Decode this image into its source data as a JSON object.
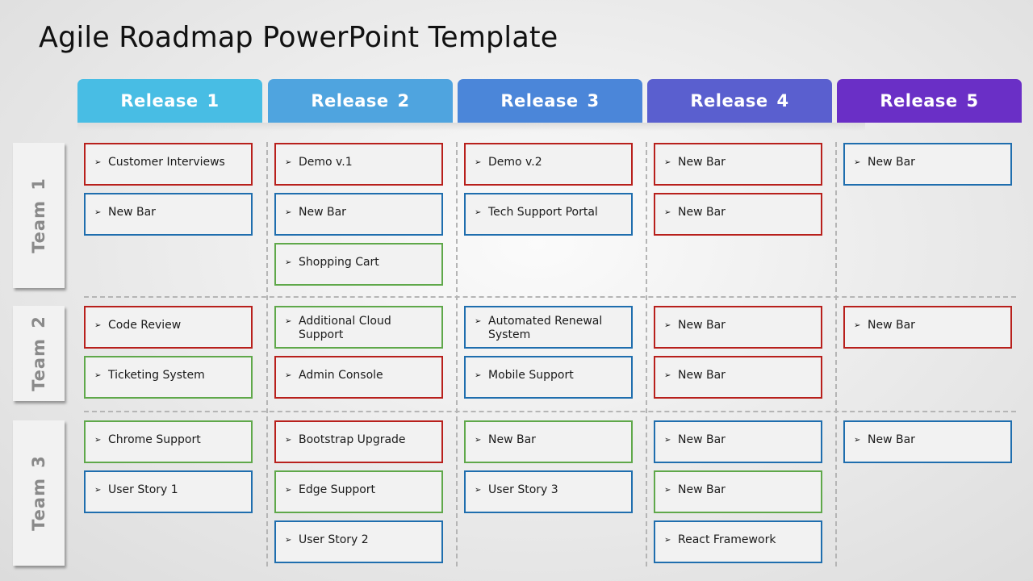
{
  "title": "Agile Roadmap PowerPoint Template",
  "colors": {
    "red": "#b8201c",
    "blue": "#1f6eae",
    "green": "#5fa84a"
  },
  "releases": [
    {
      "label": "Release 1",
      "color": "#48bde4"
    },
    {
      "label": "Release 2",
      "color": "#4fa4df"
    },
    {
      "label": "Release 3",
      "color": "#4b86d9"
    },
    {
      "label": "Release 4",
      "color": "#5a5fcf"
    },
    {
      "label": "Release 5",
      "color": "#6a2fc6"
    }
  ],
  "bullet_icon": "➢",
  "teams": [
    {
      "label": "Team 1",
      "cells": [
        [
          {
            "text": "Customer Interviews",
            "status": "red"
          },
          {
            "text": "New Bar",
            "status": "blue"
          }
        ],
        [
          {
            "text": "Demo v.1",
            "status": "red"
          },
          {
            "text": "New Bar",
            "status": "blue"
          },
          {
            "text": "Shopping Cart",
            "status": "green"
          }
        ],
        [
          {
            "text": "Demo v.2",
            "status": "red"
          },
          {
            "text": "Tech Support Portal",
            "status": "blue"
          }
        ],
        [
          {
            "text": "New Bar",
            "status": "red"
          },
          {
            "text": "New Bar",
            "status": "red"
          }
        ],
        [
          {
            "text": "New Bar",
            "status": "blue"
          }
        ]
      ]
    },
    {
      "label": "Team 2",
      "cells": [
        [
          {
            "text": "Code Review",
            "status": "red"
          },
          {
            "text": "Ticketing System",
            "status": "green"
          }
        ],
        [
          {
            "text": "Additional Cloud Support",
            "status": "green"
          },
          {
            "text": "Admin Console",
            "status": "red"
          }
        ],
        [
          {
            "text": "Automated Renewal System",
            "status": "blue"
          },
          {
            "text": "Mobile Support",
            "status": "blue"
          }
        ],
        [
          {
            "text": "New Bar",
            "status": "red"
          },
          {
            "text": "New Bar",
            "status": "red"
          }
        ],
        [
          {
            "text": "New Bar",
            "status": "red"
          }
        ]
      ]
    },
    {
      "label": "Team 3",
      "cells": [
        [
          {
            "text": "Chrome Support",
            "status": "green"
          },
          {
            "text": "User Story 1",
            "status": "blue"
          }
        ],
        [
          {
            "text": "Bootstrap Upgrade",
            "status": "red"
          },
          {
            "text": "Edge Support",
            "status": "green"
          },
          {
            "text": "User Story 2",
            "status": "blue"
          }
        ],
        [
          {
            "text": "New Bar",
            "status": "green"
          },
          {
            "text": "User Story 3",
            "status": "blue"
          }
        ],
        [
          {
            "text": "New Bar",
            "status": "blue"
          },
          {
            "text": "New Bar",
            "status": "green"
          },
          {
            "text": "React Framework",
            "status": "blue"
          }
        ],
        [
          {
            "text": "New Bar",
            "status": "blue"
          }
        ]
      ]
    }
  ]
}
